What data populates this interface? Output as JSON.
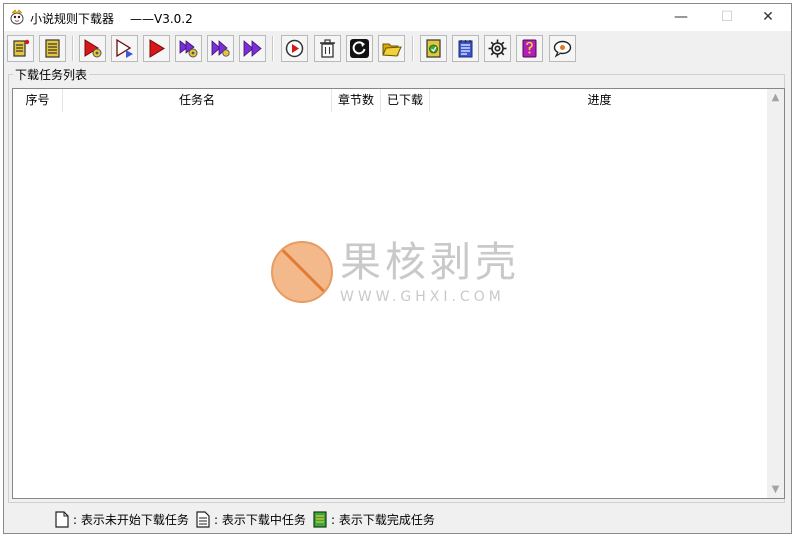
{
  "window": {
    "title": "小说规则下载器",
    "version": "——V3.0.2",
    "minimize_glyph": "—",
    "maximize_glyph": "☐",
    "close_glyph": "✕"
  },
  "toolbar": {
    "buttons": [
      {
        "icon": "new-rule-icon"
      },
      {
        "icon": "book-list-icon"
      },
      {
        "icon": "start-settings-icon"
      },
      {
        "icon": "start-queue-icon"
      },
      {
        "icon": "start-icon"
      },
      {
        "icon": "start-all-settings-icon"
      },
      {
        "icon": "start-double-settings-icon"
      },
      {
        "icon": "start-all-icon"
      },
      {
        "icon": "refresh-icon"
      },
      {
        "icon": "delete-icon"
      },
      {
        "icon": "reset-icon"
      },
      {
        "icon": "open-folder-icon"
      },
      {
        "icon": "export-icon"
      },
      {
        "icon": "notepad-icon"
      },
      {
        "icon": "settings-icon"
      },
      {
        "icon": "help-book-icon"
      },
      {
        "icon": "chat-icon"
      }
    ]
  },
  "task_group": {
    "legend": "下载任务列表",
    "columns": [
      "序号",
      "任务名",
      "章节数",
      "已下载",
      "进度"
    ],
    "rows": []
  },
  "watermark": {
    "text": "果核剥壳",
    "url": "WWW.GHXI.COM"
  },
  "statusbar": {
    "items": [
      {
        "icon": "not-started-doc-icon",
        "label": ": 表示未开始下载任务"
      },
      {
        "icon": "downloading-doc-icon",
        "label": ": 表示下载中任务"
      },
      {
        "icon": "completed-doc-icon",
        "label": ": 表示下载完成任务"
      }
    ]
  },
  "colors": {
    "play_red": "#d8171a",
    "play_purple": "#7a2fd6",
    "icon_gold": "#e4c53b",
    "watermark_orange": "#f3b98a"
  }
}
